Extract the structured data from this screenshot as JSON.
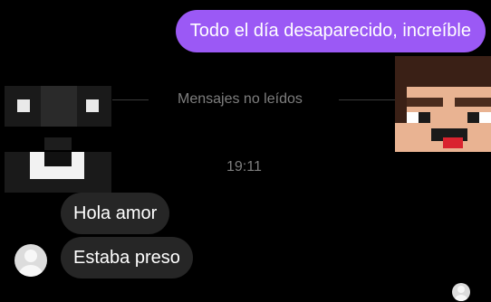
{
  "thread": {
    "outgoing": [
      {
        "text": "Todo el día desaparecido, increíble"
      }
    ],
    "unread_divider": "Mensajes no leídos",
    "timestamp": "19:11",
    "incoming": [
      {
        "text": "Hola amor"
      },
      {
        "text": "Estaba preso"
      }
    ]
  },
  "colors": {
    "accent": "#9b59f5",
    "incoming_bubble": "#262626",
    "background": "#000000",
    "muted_text": "#7e7e7e"
  },
  "icons": {
    "sender_avatar": "default-user-avatar",
    "read_receipt": "mini-user-avatar",
    "sticker_left": "pixel-face-sticker",
    "sticker_right": "pixel-character-sticker"
  }
}
